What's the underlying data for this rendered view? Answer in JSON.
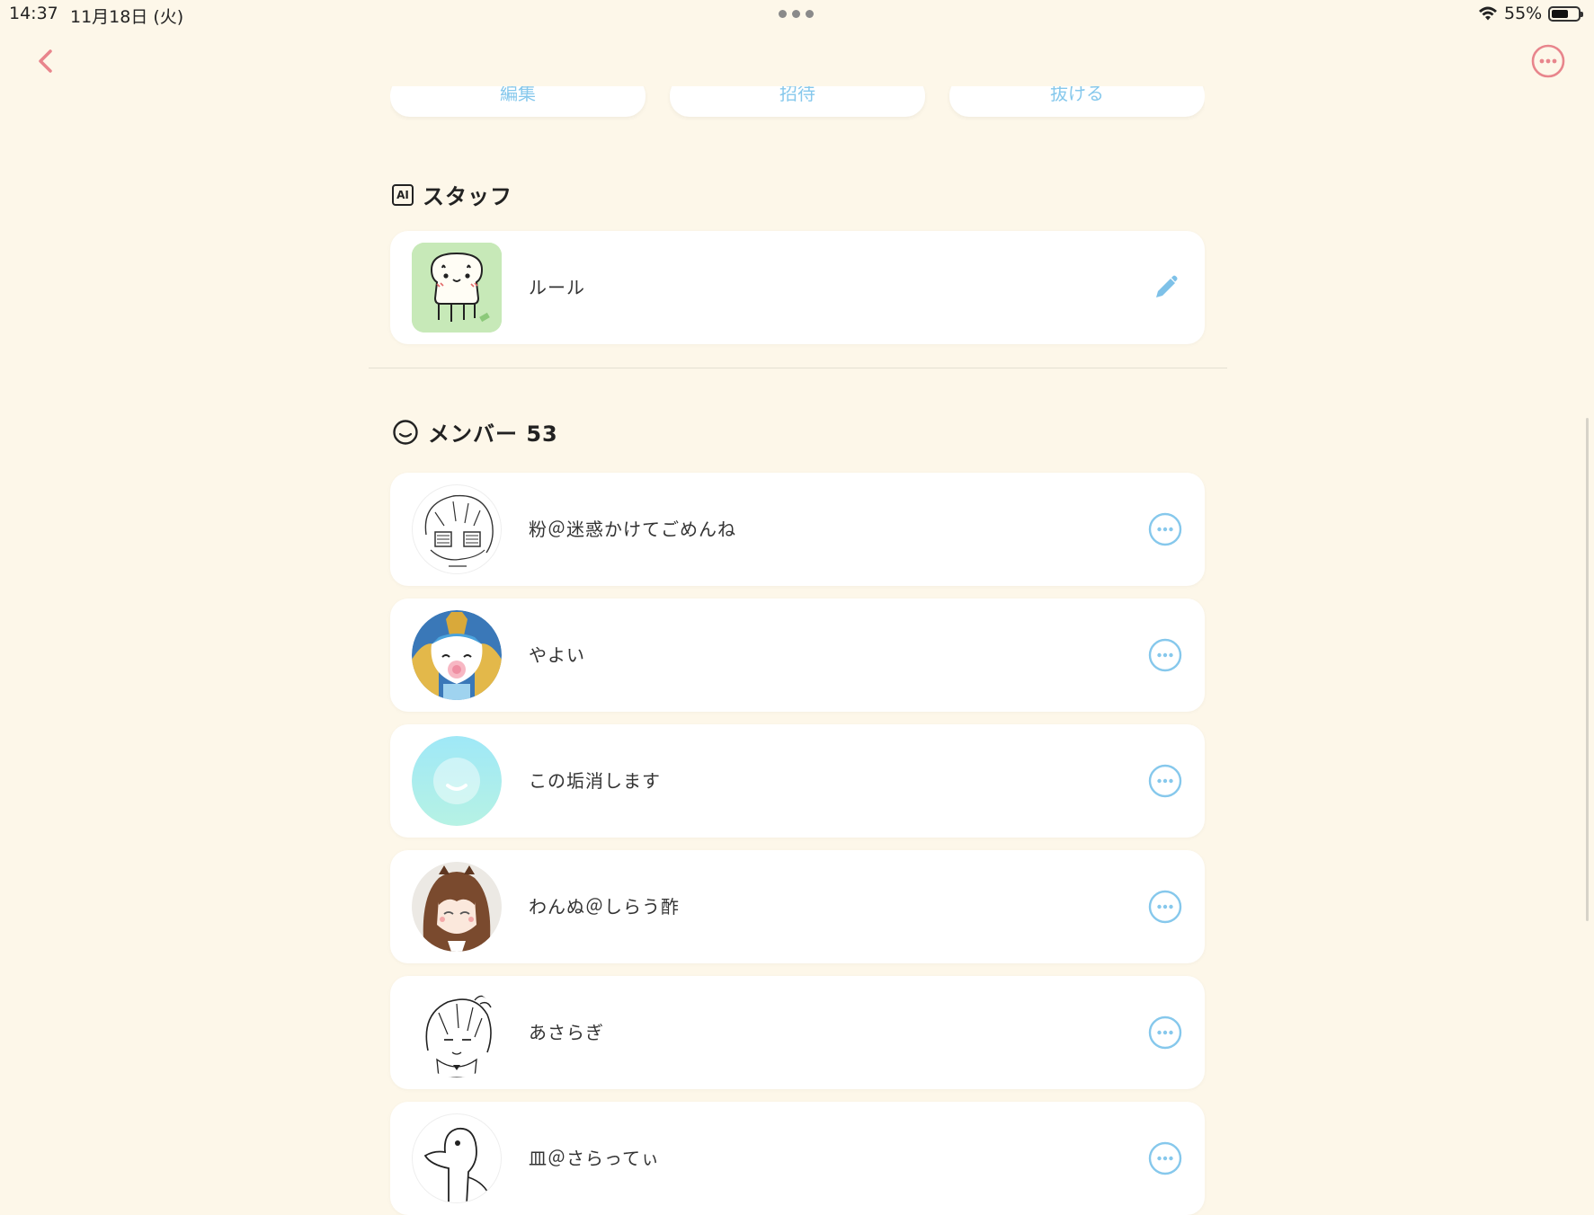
{
  "status_bar": {
    "time": "14:37",
    "date": "11月18日 (火)",
    "battery": "55%"
  },
  "actions": {
    "edit": "編集",
    "invite": "招待",
    "leave": "抜ける"
  },
  "staff": {
    "title": "スタッフ",
    "icon_label": "AI",
    "items": [
      {
        "name": "ルール",
        "action": "pencil-icon"
      }
    ]
  },
  "members": {
    "title": "メンバー 53",
    "items": [
      {
        "name": "粉＠迷惑かけてごめんね"
      },
      {
        "name": "やよい"
      },
      {
        "name": "この垢消します"
      },
      {
        "name": "わんぬ＠しらう酢"
      },
      {
        "name": "あさらぎ"
      },
      {
        "name": "皿＠さらってぃ"
      }
    ]
  },
  "colors": {
    "background": "#fdf7e9",
    "accent_pink": "#e8858c",
    "accent_blue": "#86c8ec"
  }
}
